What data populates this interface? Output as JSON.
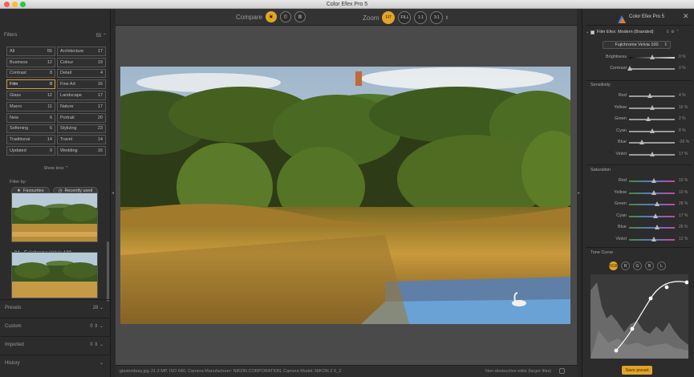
{
  "window": {
    "title": "Color Efex Pro 5"
  },
  "left_panel": {
    "filters_label": "Filters",
    "filters_count": "55",
    "filter_cells": [
      {
        "label": "All",
        "count": "55"
      },
      {
        "label": "Architecture",
        "count": "17"
      },
      {
        "label": "Business",
        "count": "12"
      },
      {
        "label": "Colour",
        "count": "19"
      },
      {
        "label": "Contrast",
        "count": "8"
      },
      {
        "label": "Detail",
        "count": "4"
      },
      {
        "label": "Film",
        "count": "8"
      },
      {
        "label": "Fine Art",
        "count": "16"
      },
      {
        "label": "Glass",
        "count": "12"
      },
      {
        "label": "Landscape",
        "count": "17"
      },
      {
        "label": "Macro",
        "count": "11"
      },
      {
        "label": "Nature",
        "count": "17"
      },
      {
        "label": "New",
        "count": "6"
      },
      {
        "label": "Portrait",
        "count": "20"
      },
      {
        "label": "Softening",
        "count": "6"
      },
      {
        "label": "Stylizing",
        "count": "23"
      },
      {
        "label": "Traditional",
        "count": "14"
      },
      {
        "label": "Travel",
        "count": "14"
      },
      {
        "label": "Updated",
        "count": "9"
      },
      {
        "label": "Wedding",
        "count": "16"
      }
    ],
    "show_less": "Show less",
    "filter_by": "Filter by:",
    "favourites": "Favourites",
    "recently_used": "Recently used",
    "thumb_caption": "04 - Fujichrome Velvia 100",
    "sections": [
      {
        "label": "Presets",
        "count": "28"
      },
      {
        "label": "Custom",
        "count": "0"
      },
      {
        "label": "Imported",
        "count": "0"
      },
      {
        "label": "History",
        "count": ""
      }
    ]
  },
  "toolbar": {
    "compare_label": "Compare",
    "zoom_label": "Zoom",
    "zoom_options": [
      "FIT",
      "FILL",
      "1:1",
      "3:1"
    ]
  },
  "status": {
    "filename": "glastonbury.jpg",
    "info": "21.3 MP, ISO 640, Camera Manufacturer: NIKON CORPORATION, Camera Model: NIKON Z 6_2",
    "right_note": "Non-destructive edits (larger files)"
  },
  "right_panel": {
    "product": "Color Efex Pro 5",
    "filter_name": "Film Efex: Modern (Branded)",
    "film_select": "Fujichrome Velvia 100",
    "brightness": {
      "label": "Brightness",
      "value": "0 %",
      "pos": 0.5
    },
    "contrast": {
      "label": "Contrast",
      "value": "0 %",
      "pos": 0.02
    },
    "sensitivity_title": "Sensitivity",
    "sensitivity": [
      {
        "label": "Red",
        "value": "4 %",
        "pos": 0.45
      },
      {
        "label": "Yellow",
        "value": "16 %",
        "pos": 0.5
      },
      {
        "label": "Green",
        "value": "2 %",
        "pos": 0.42
      },
      {
        "label": "Cyan",
        "value": "8 %",
        "pos": 0.5
      },
      {
        "label": "Blue",
        "value": "-26 %",
        "pos": 0.28
      },
      {
        "label": "Violet",
        "value": "17 %",
        "pos": 0.5
      }
    ],
    "saturation_title": "Saturation",
    "saturation": [
      {
        "label": "Red",
        "value": "10 %",
        "pos": 0.55
      },
      {
        "label": "Yellow",
        "value": "10 %",
        "pos": 0.55
      },
      {
        "label": "Green",
        "value": "28 %",
        "pos": 0.62
      },
      {
        "label": "Cyan",
        "value": "17 %",
        "pos": 0.58
      },
      {
        "label": "Blue",
        "value": "26 %",
        "pos": 0.62
      },
      {
        "label": "Violet",
        "value": "12 %",
        "pos": 0.55
      }
    ],
    "tone_curve_title": "Tone Curve",
    "tone_buttons": [
      "RGB",
      "R",
      "G",
      "B",
      "L"
    ],
    "save_preset": "Save preset",
    "accent": "#e2a428"
  }
}
